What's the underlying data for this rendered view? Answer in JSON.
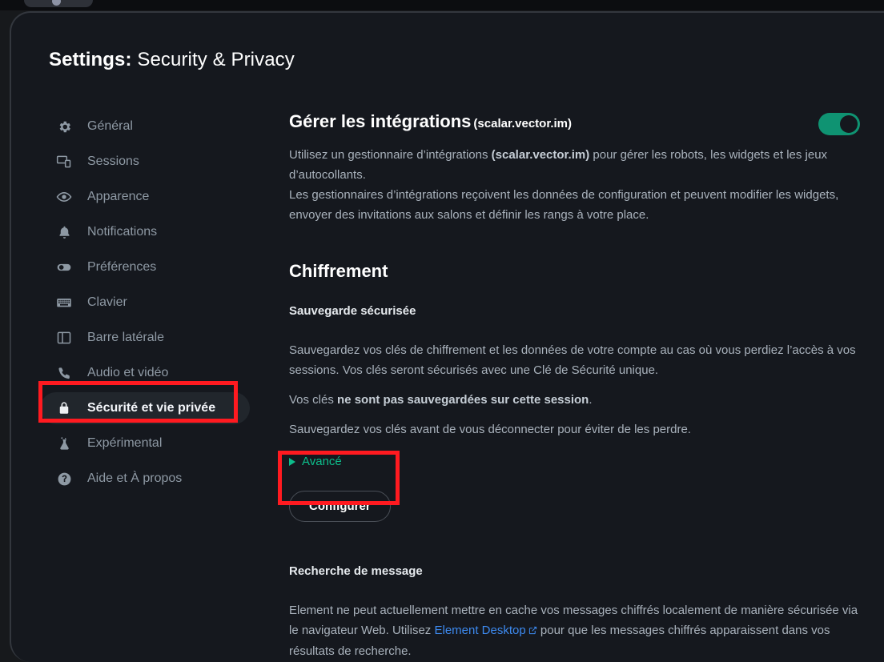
{
  "window": {
    "dialog_title_bold": "Settings:",
    "dialog_title_rest": " Security & Privacy"
  },
  "sidebar": {
    "items": [
      {
        "label": "Général",
        "icon": "gear-icon",
        "selected": false
      },
      {
        "label": "Sessions",
        "icon": "devices-icon",
        "selected": false
      },
      {
        "label": "Apparence",
        "icon": "eye-icon",
        "selected": false
      },
      {
        "label": "Notifications",
        "icon": "bell-icon",
        "selected": false
      },
      {
        "label": "Préférences",
        "icon": "toggle-icon",
        "selected": false
      },
      {
        "label": "Clavier",
        "icon": "keyboard-icon",
        "selected": false
      },
      {
        "label": "Barre latérale",
        "icon": "sidebar-icon",
        "selected": false
      },
      {
        "label": "Audio et vidéo",
        "icon": "phone-icon",
        "selected": false
      },
      {
        "label": "Sécurité et vie privée",
        "icon": "lock-icon",
        "selected": true
      },
      {
        "label": "Expérimental",
        "icon": "flask-icon",
        "selected": false
      },
      {
        "label": "Aide et À propos",
        "icon": "question-mark-icon",
        "selected": false
      }
    ]
  },
  "integrations": {
    "heading": "Gérer les intégrations",
    "heading_suffix": "(scalar.vector.im)",
    "description_part1": "Utilisez un gestionnaire d’intégrations ",
    "description_bold": "(scalar.vector.im)",
    "description_part2": " pour gérer les robots, les widgets et les jeux d’autocollants.",
    "description_line2": "Les gestionnaires d’intégrations reçoivent les données de configuration et peuvent modifier les widgets, envoyer des invitations aux salons et définir les rangs à votre place.",
    "toggle_state": "on",
    "toggle_color": "#0F9372"
  },
  "encryption": {
    "heading": "Chiffrement",
    "backup": {
      "subheading": "Sauvegarde sécurisée",
      "paragraph1": "Sauvegardez vos clés de chiffrement et les données de votre compte au cas où vous perdiez l’accès à vos sessions. Vos clés seront sécurisés avec une Clé de Sécurité unique.",
      "paragraph2_prefix": "Vos clés ",
      "paragraph2_bold": "ne sont pas sauvegardées sur cette session",
      "paragraph2_suffix": ".",
      "paragraph3": "Sauvegardez vos clés avant de vous déconnecter pour éviter de les perdre.",
      "advanced_label": "Avancé",
      "advanced_color": "#0DBD8B",
      "configure_button_label": "Configurer"
    },
    "search": {
      "subheading": "Recherche de message",
      "paragraph_prefix": "Element ne peut actuellement mettre en cache vos messages chiffrés localement de manière sécurisée via le navigateur Web. Utilisez ",
      "link_label": "Element Desktop",
      "paragraph_suffix": " pour que les messages chiffrés apparaissent dans vos résultats de recherche.",
      "link_color": "#3D8AF0"
    }
  },
  "annotations": {
    "color": "#FF1A20",
    "boxes": [
      {
        "name": "sidebar-security-highlight"
      },
      {
        "name": "configure-button-highlight"
      }
    ]
  }
}
